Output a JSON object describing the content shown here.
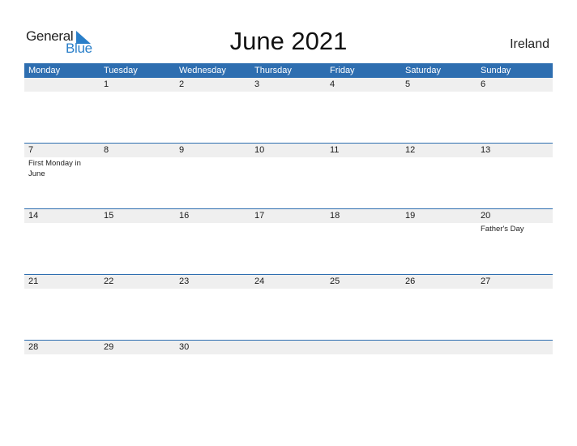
{
  "logo": {
    "line1": "General",
    "line2": "Blue",
    "icon": "triangle-flag-icon"
  },
  "title": "June 2021",
  "country": "Ireland",
  "colors": {
    "header_bg": "#2e6eb0",
    "date_strip_bg": "#efefef",
    "logo_blue": "#2a7fc9"
  },
  "weekdays": [
    "Monday",
    "Tuesday",
    "Wednesday",
    "Thursday",
    "Friday",
    "Saturday",
    "Sunday"
  ],
  "weeks": [
    {
      "days": [
        "",
        "1",
        "2",
        "3",
        "4",
        "5",
        "6"
      ],
      "events": [
        "",
        "",
        "",
        "",
        "",
        "",
        ""
      ]
    },
    {
      "days": [
        "7",
        "8",
        "9",
        "10",
        "11",
        "12",
        "13"
      ],
      "events": [
        "First Monday in June",
        "",
        "",
        "",
        "",
        "",
        ""
      ]
    },
    {
      "days": [
        "14",
        "15",
        "16",
        "17",
        "18",
        "19",
        "20"
      ],
      "events": [
        "",
        "",
        "",
        "",
        "",
        "",
        "Father's Day"
      ]
    },
    {
      "days": [
        "21",
        "22",
        "23",
        "24",
        "25",
        "26",
        "27"
      ],
      "events": [
        "",
        "",
        "",
        "",
        "",
        "",
        ""
      ]
    },
    {
      "days": [
        "28",
        "29",
        "30",
        "",
        "",
        "",
        ""
      ],
      "events": [
        "",
        "",
        "",
        "",
        "",
        "",
        ""
      ]
    }
  ]
}
